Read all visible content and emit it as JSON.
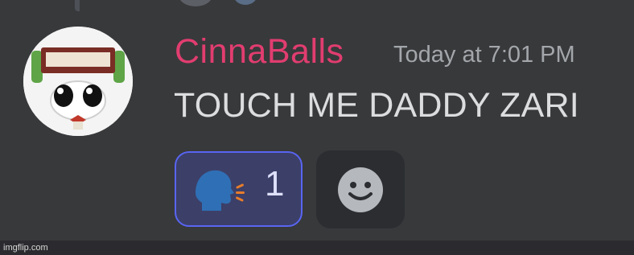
{
  "message": {
    "username": "CinnaBalls",
    "timestamp": "Today at 7:01 PM",
    "content": "TOUCH ME DADDY ZARI"
  },
  "reactions": [
    {
      "emoji": "speaking-head-icon",
      "count": "1",
      "active": true
    }
  ],
  "add_reaction": {
    "icon": "smiley-face-icon"
  },
  "colors": {
    "background": "#38393b",
    "username": "#e23d70",
    "timestamp": "#a3a6aa",
    "message_text": "#dcddde",
    "reaction_border": "#5865f2",
    "reaction_bg": "#3c3f68"
  },
  "watermark": "imgflip.com"
}
